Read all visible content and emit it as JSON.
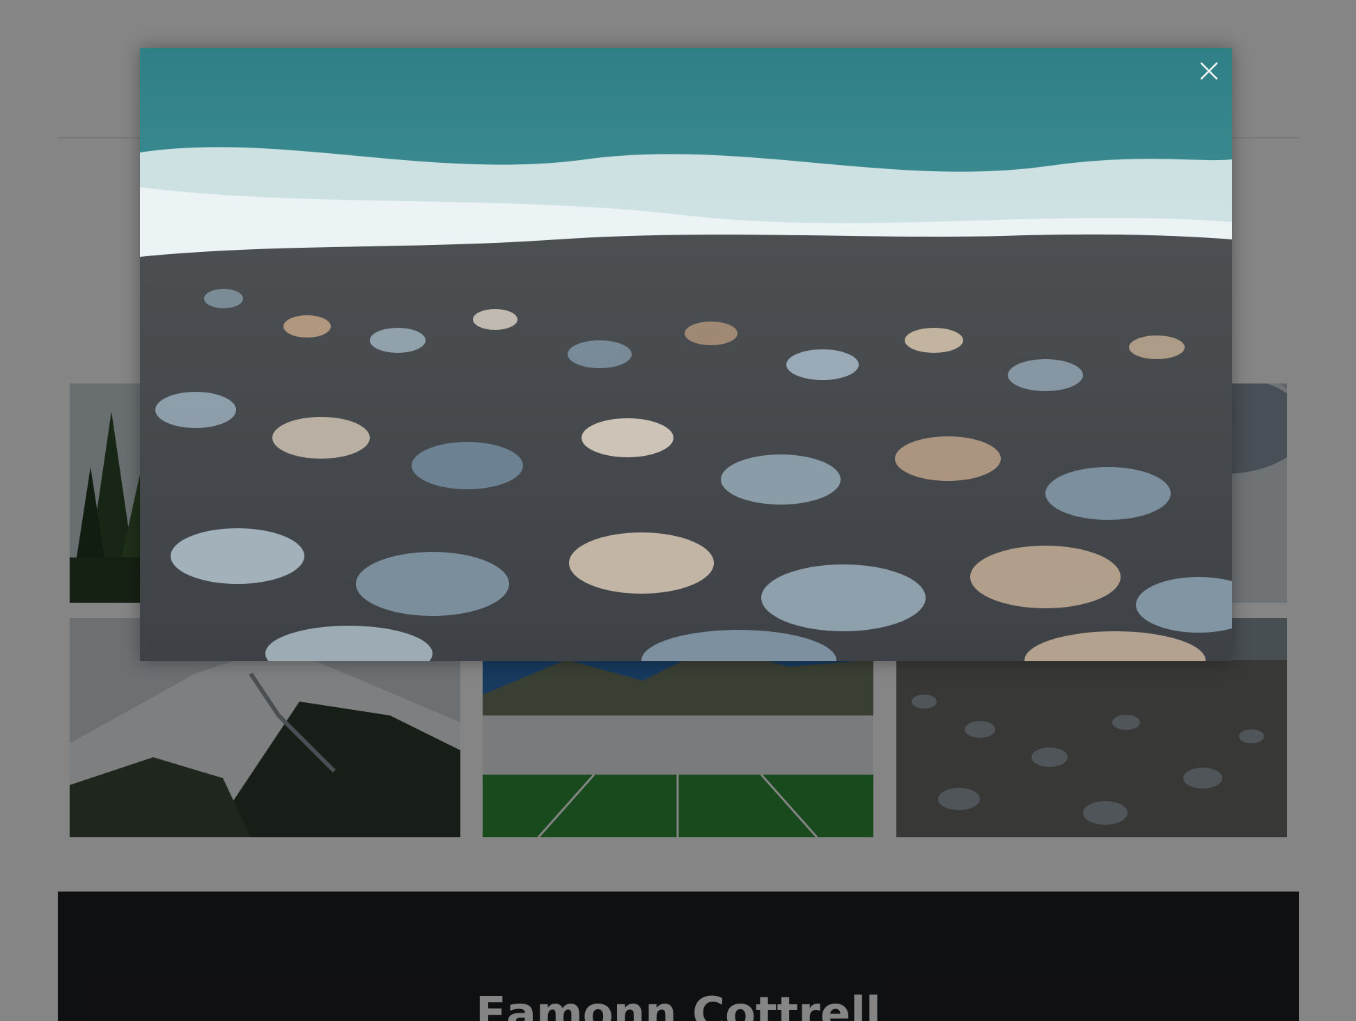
{
  "footer": {
    "name": "Eamonn Cottrell"
  },
  "gallery": {
    "tiles": [
      {
        "subject": "forest-trees"
      },
      {
        "subject": "knit-fabric"
      },
      {
        "subject": "snowy-mountain"
      },
      {
        "subject": "football-stadium"
      },
      {
        "subject": "pebble-beach"
      }
    ]
  },
  "lightbox": {
    "subject": "pebble-beach-with-wave",
    "close_icon": "close-icon",
    "close_label": "×"
  },
  "colors": {
    "overlay": "#000000",
    "footer_background": "#1e1f23",
    "footer_text": "#ffffff",
    "close_icon": "#ffffff"
  }
}
